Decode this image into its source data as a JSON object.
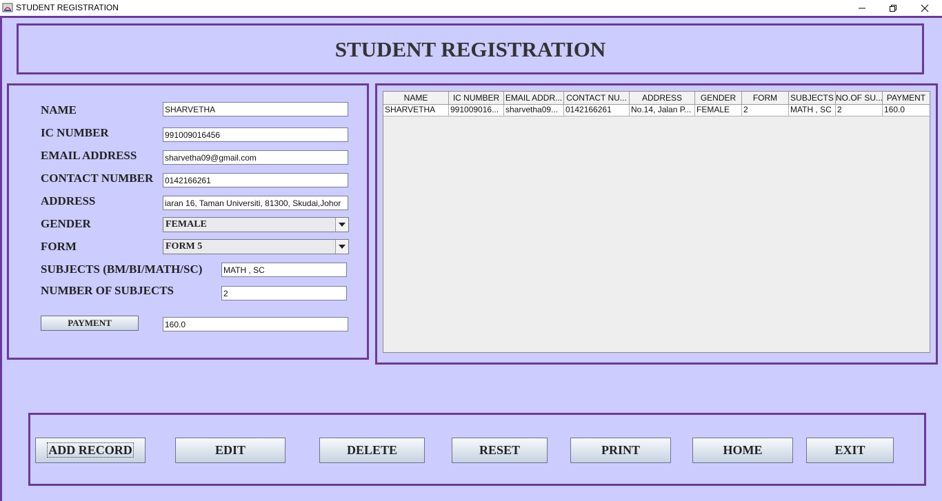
{
  "window": {
    "title": "STUDENT REGISTRATION",
    "controls": [
      "minimize-icon",
      "restore-icon",
      "close-icon"
    ]
  },
  "header": {
    "title": "STUDENT REGISTRATION"
  },
  "form": {
    "name_label": "NAME",
    "name_value": "SHARVETHA",
    "ic_label": "IC NUMBER",
    "ic_value": "991009016456",
    "email_label": "EMAIL ADDRESS",
    "email_value": "sharvetha09@gmail.com",
    "contact_label": "CONTACT NUMBER",
    "contact_value": "0142166261",
    "address_label": "ADDRESS",
    "address_value": "iaran 16, Taman Universiti, 81300, Skudai,Johor",
    "gender_label": "GENDER",
    "gender_value": "FEMALE",
    "form_label": "FORM",
    "form_value": "FORM 5",
    "subjects_label": "SUBJECTS (BM/BI/MATH/SC)",
    "subjects_value": "MATH , SC",
    "num_subjects_label": "NUMBER OF SUBJECTS",
    "num_subjects_value": "2",
    "payment_button": "PAYMENT",
    "payment_value": "160.0"
  },
  "table": {
    "columns": [
      "NAME",
      "IC NUMBER",
      "EMAIL ADDR...",
      "CONTACT NU...",
      "ADDRESS",
      "GENDER",
      "FORM",
      "SUBJECTS",
      "NO.OF SU...",
      "PAYMENT"
    ],
    "rows": [
      [
        "SHARVETHA",
        "991009016...",
        "sharvetha09...",
        "0142166261",
        "No.14, Jalan P...",
        "FEMALE",
        "2",
        "MATH , SC",
        "2",
        "160.0"
      ]
    ]
  },
  "actions": {
    "add": "ADD RECORD",
    "edit": "EDIT",
    "delete": "DELETE",
    "reset": "RESET",
    "print": "PRINT",
    "home": "HOME",
    "exit": "EXIT"
  },
  "colors": {
    "background": "#ccccff",
    "border": "#6a3a9a"
  }
}
